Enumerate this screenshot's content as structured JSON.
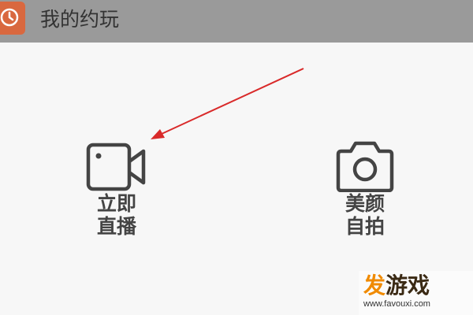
{
  "app": {
    "title": "我的约玩",
    "icon": "clock-icon",
    "icon_color": "#d9683f",
    "titlebar_color": "#9a9a9a"
  },
  "actions": [
    {
      "id": "live",
      "icon": "video-camera-icon",
      "label_line1": "立即",
      "label_line2": "直播"
    },
    {
      "id": "beauty",
      "icon": "camera-icon",
      "label_line1": "美颜",
      "label_line2": "自拍"
    }
  ],
  "annotation": {
    "arrow_color": "#d92a2a",
    "points_to": "video-camera-icon"
  },
  "watermark": {
    "accent_char": "发",
    "rest": "游戏",
    "url": "www.favouxi.com"
  }
}
